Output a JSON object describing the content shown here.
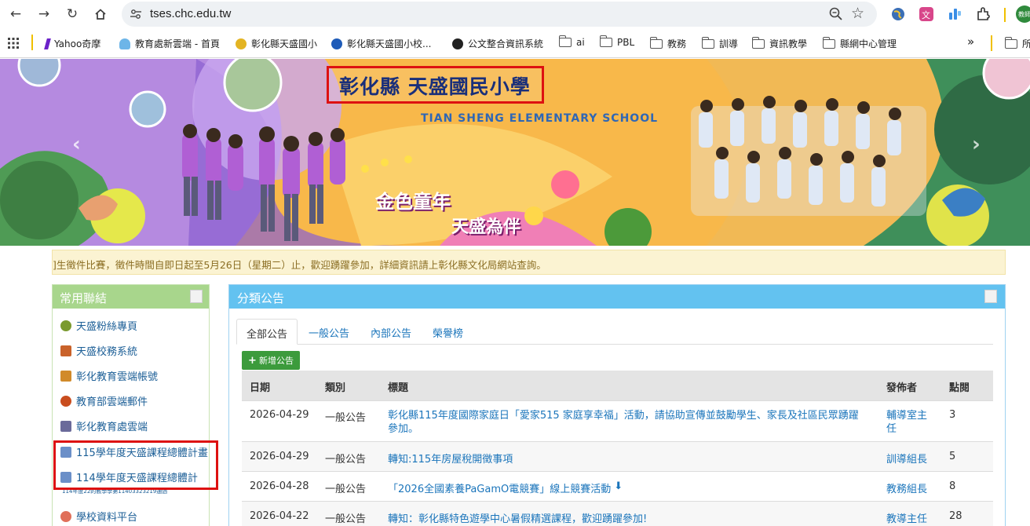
{
  "browser": {
    "url": "tses.chc.edu.tw",
    "profile": "教師"
  },
  "bookmarks": [
    {
      "label": "Yahoo奇摩"
    },
    {
      "label": "教育處新雲端 - 首頁"
    },
    {
      "label": "彰化縣天盛國小"
    },
    {
      "label": "彰化縣天盛國小校..."
    },
    {
      "label": "公文整合資訊系統"
    },
    {
      "label": "ai"
    },
    {
      "label": "PBL"
    },
    {
      "label": "教務"
    },
    {
      "label": "訓導"
    },
    {
      "label": "資訊教學"
    },
    {
      "label": "縣網中心管理"
    },
    {
      "label": "所"
    }
  ],
  "banner": {
    "title": "彰化縣 天盛國民小學",
    "subtitle": "TIAN SHENG ELEMENTARY SCHOOL",
    "slogan1": "金色童年",
    "slogan2": "天盛為伴"
  },
  "marquee": "]生徵件比賽，徵件時間自即日起至5月26日（星期二）止，歡迎踴躍參加，詳細資訊請上彰化縣文化局網站查詢。",
  "sidebar": {
    "title": "常用聯結",
    "links": [
      {
        "label": "天盛粉絲專頁",
        "icon_color": "#7a9a2e"
      },
      {
        "label": "天盛校務系統",
        "icon_color": "#c9622a"
      },
      {
        "label": "彰化教育雲端帳號",
        "icon_color": "#d18a2a"
      },
      {
        "label": "教育部雲端郵件",
        "icon_color": "#c94d1e"
      },
      {
        "label": "彰化教育處雲端",
        "icon_color": "#6a6a9a"
      },
      {
        "label": "115學年度天盛課程總體計畫",
        "icon_color": "#6b8fc8"
      },
      {
        "label": "114學年度天盛課程總體計",
        "icon_color": "#6b8fc8"
      },
      {
        "label": "學校資料平台",
        "icon_color": "#e0705a"
      }
    ],
    "small_text": "114年度22的教學學第11403323219通過"
  },
  "main": {
    "title": "分類公告",
    "tabs": [
      "全部公告",
      "一般公告",
      "內部公告",
      "榮譽榜"
    ],
    "add_button": "新增公告",
    "columns": [
      "日期",
      "類別",
      "標題",
      "發佈者",
      "點閱"
    ],
    "rows": [
      {
        "date": "2026-04-29",
        "category": "一般公告",
        "title": "彰化縣115年度國際家庭日「愛家515 家庭享幸福」活動，請協助宣傳並鼓勵學生、家長及社區民眾踴躍參加。",
        "publisher": "輔導室主任",
        "clicks": "3"
      },
      {
        "date": "2026-04-29",
        "category": "一般公告",
        "title": "轉知:115年房屋稅開徵事項",
        "publisher": "訓導組長",
        "clicks": "5"
      },
      {
        "date": "2026-04-28",
        "category": "一般公告",
        "title": "「2026全國素養PaGamO電競賽」線上競賽活動",
        "publisher": "教務組長",
        "clicks": "8"
      },
      {
        "date": "2026-04-22",
        "category": "一般公告",
        "title": "轉知：彰化縣特色遊學中心暑假精選課程，歡迎踴躍參加!",
        "publisher": "教導主任",
        "clicks": "28"
      }
    ]
  }
}
